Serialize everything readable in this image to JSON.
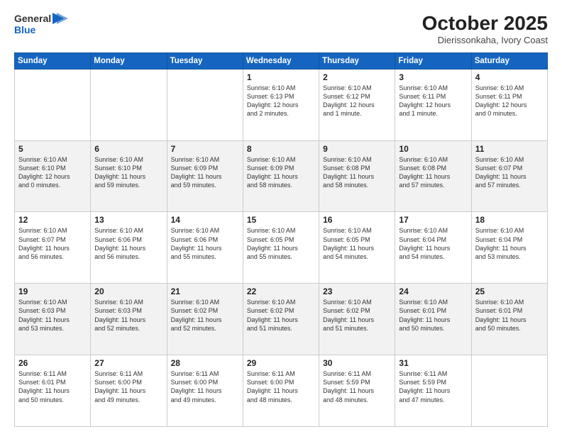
{
  "header": {
    "logo_line1": "General",
    "logo_line2": "Blue",
    "month": "October 2025",
    "location": "Dierissonkaha, Ivory Coast"
  },
  "weekdays": [
    "Sunday",
    "Monday",
    "Tuesday",
    "Wednesday",
    "Thursday",
    "Friday",
    "Saturday"
  ],
  "rows": [
    {
      "cells": [
        {
          "day": "",
          "info": ""
        },
        {
          "day": "",
          "info": ""
        },
        {
          "day": "",
          "info": ""
        },
        {
          "day": "1",
          "info": "Sunrise: 6:10 AM\nSunset: 6:13 PM\nDaylight: 12 hours\nand 2 minutes."
        },
        {
          "day": "2",
          "info": "Sunrise: 6:10 AM\nSunset: 6:12 PM\nDaylight: 12 hours\nand 1 minute."
        },
        {
          "day": "3",
          "info": "Sunrise: 6:10 AM\nSunset: 6:11 PM\nDaylight: 12 hours\nand 1 minute."
        },
        {
          "day": "4",
          "info": "Sunrise: 6:10 AM\nSunset: 6:11 PM\nDaylight: 12 hours\nand 0 minutes."
        }
      ],
      "shaded": false
    },
    {
      "cells": [
        {
          "day": "5",
          "info": "Sunrise: 6:10 AM\nSunset: 6:10 PM\nDaylight: 12 hours\nand 0 minutes."
        },
        {
          "day": "6",
          "info": "Sunrise: 6:10 AM\nSunset: 6:10 PM\nDaylight: 11 hours\nand 59 minutes."
        },
        {
          "day": "7",
          "info": "Sunrise: 6:10 AM\nSunset: 6:09 PM\nDaylight: 11 hours\nand 59 minutes."
        },
        {
          "day": "8",
          "info": "Sunrise: 6:10 AM\nSunset: 6:09 PM\nDaylight: 11 hours\nand 58 minutes."
        },
        {
          "day": "9",
          "info": "Sunrise: 6:10 AM\nSunset: 6:08 PM\nDaylight: 11 hours\nand 58 minutes."
        },
        {
          "day": "10",
          "info": "Sunrise: 6:10 AM\nSunset: 6:08 PM\nDaylight: 11 hours\nand 57 minutes."
        },
        {
          "day": "11",
          "info": "Sunrise: 6:10 AM\nSunset: 6:07 PM\nDaylight: 11 hours\nand 57 minutes."
        }
      ],
      "shaded": true
    },
    {
      "cells": [
        {
          "day": "12",
          "info": "Sunrise: 6:10 AM\nSunset: 6:07 PM\nDaylight: 11 hours\nand 56 minutes."
        },
        {
          "day": "13",
          "info": "Sunrise: 6:10 AM\nSunset: 6:06 PM\nDaylight: 11 hours\nand 56 minutes."
        },
        {
          "day": "14",
          "info": "Sunrise: 6:10 AM\nSunset: 6:06 PM\nDaylight: 11 hours\nand 55 minutes."
        },
        {
          "day": "15",
          "info": "Sunrise: 6:10 AM\nSunset: 6:05 PM\nDaylight: 11 hours\nand 55 minutes."
        },
        {
          "day": "16",
          "info": "Sunrise: 6:10 AM\nSunset: 6:05 PM\nDaylight: 11 hours\nand 54 minutes."
        },
        {
          "day": "17",
          "info": "Sunrise: 6:10 AM\nSunset: 6:04 PM\nDaylight: 11 hours\nand 54 minutes."
        },
        {
          "day": "18",
          "info": "Sunrise: 6:10 AM\nSunset: 6:04 PM\nDaylight: 11 hours\nand 53 minutes."
        }
      ],
      "shaded": false
    },
    {
      "cells": [
        {
          "day": "19",
          "info": "Sunrise: 6:10 AM\nSunset: 6:03 PM\nDaylight: 11 hours\nand 53 minutes."
        },
        {
          "day": "20",
          "info": "Sunrise: 6:10 AM\nSunset: 6:03 PM\nDaylight: 11 hours\nand 52 minutes."
        },
        {
          "day": "21",
          "info": "Sunrise: 6:10 AM\nSunset: 6:02 PM\nDaylight: 11 hours\nand 52 minutes."
        },
        {
          "day": "22",
          "info": "Sunrise: 6:10 AM\nSunset: 6:02 PM\nDaylight: 11 hours\nand 51 minutes."
        },
        {
          "day": "23",
          "info": "Sunrise: 6:10 AM\nSunset: 6:02 PM\nDaylight: 11 hours\nand 51 minutes."
        },
        {
          "day": "24",
          "info": "Sunrise: 6:10 AM\nSunset: 6:01 PM\nDaylight: 11 hours\nand 50 minutes."
        },
        {
          "day": "25",
          "info": "Sunrise: 6:10 AM\nSunset: 6:01 PM\nDaylight: 11 hours\nand 50 minutes."
        }
      ],
      "shaded": true
    },
    {
      "cells": [
        {
          "day": "26",
          "info": "Sunrise: 6:11 AM\nSunset: 6:01 PM\nDaylight: 11 hours\nand 50 minutes."
        },
        {
          "day": "27",
          "info": "Sunrise: 6:11 AM\nSunset: 6:00 PM\nDaylight: 11 hours\nand 49 minutes."
        },
        {
          "day": "28",
          "info": "Sunrise: 6:11 AM\nSunset: 6:00 PM\nDaylight: 11 hours\nand 49 minutes."
        },
        {
          "day": "29",
          "info": "Sunrise: 6:11 AM\nSunset: 6:00 PM\nDaylight: 11 hours\nand 48 minutes."
        },
        {
          "day": "30",
          "info": "Sunrise: 6:11 AM\nSunset: 5:59 PM\nDaylight: 11 hours\nand 48 minutes."
        },
        {
          "day": "31",
          "info": "Sunrise: 6:11 AM\nSunset: 5:59 PM\nDaylight: 11 hours\nand 47 minutes."
        },
        {
          "day": "",
          "info": ""
        }
      ],
      "shaded": false
    }
  ]
}
